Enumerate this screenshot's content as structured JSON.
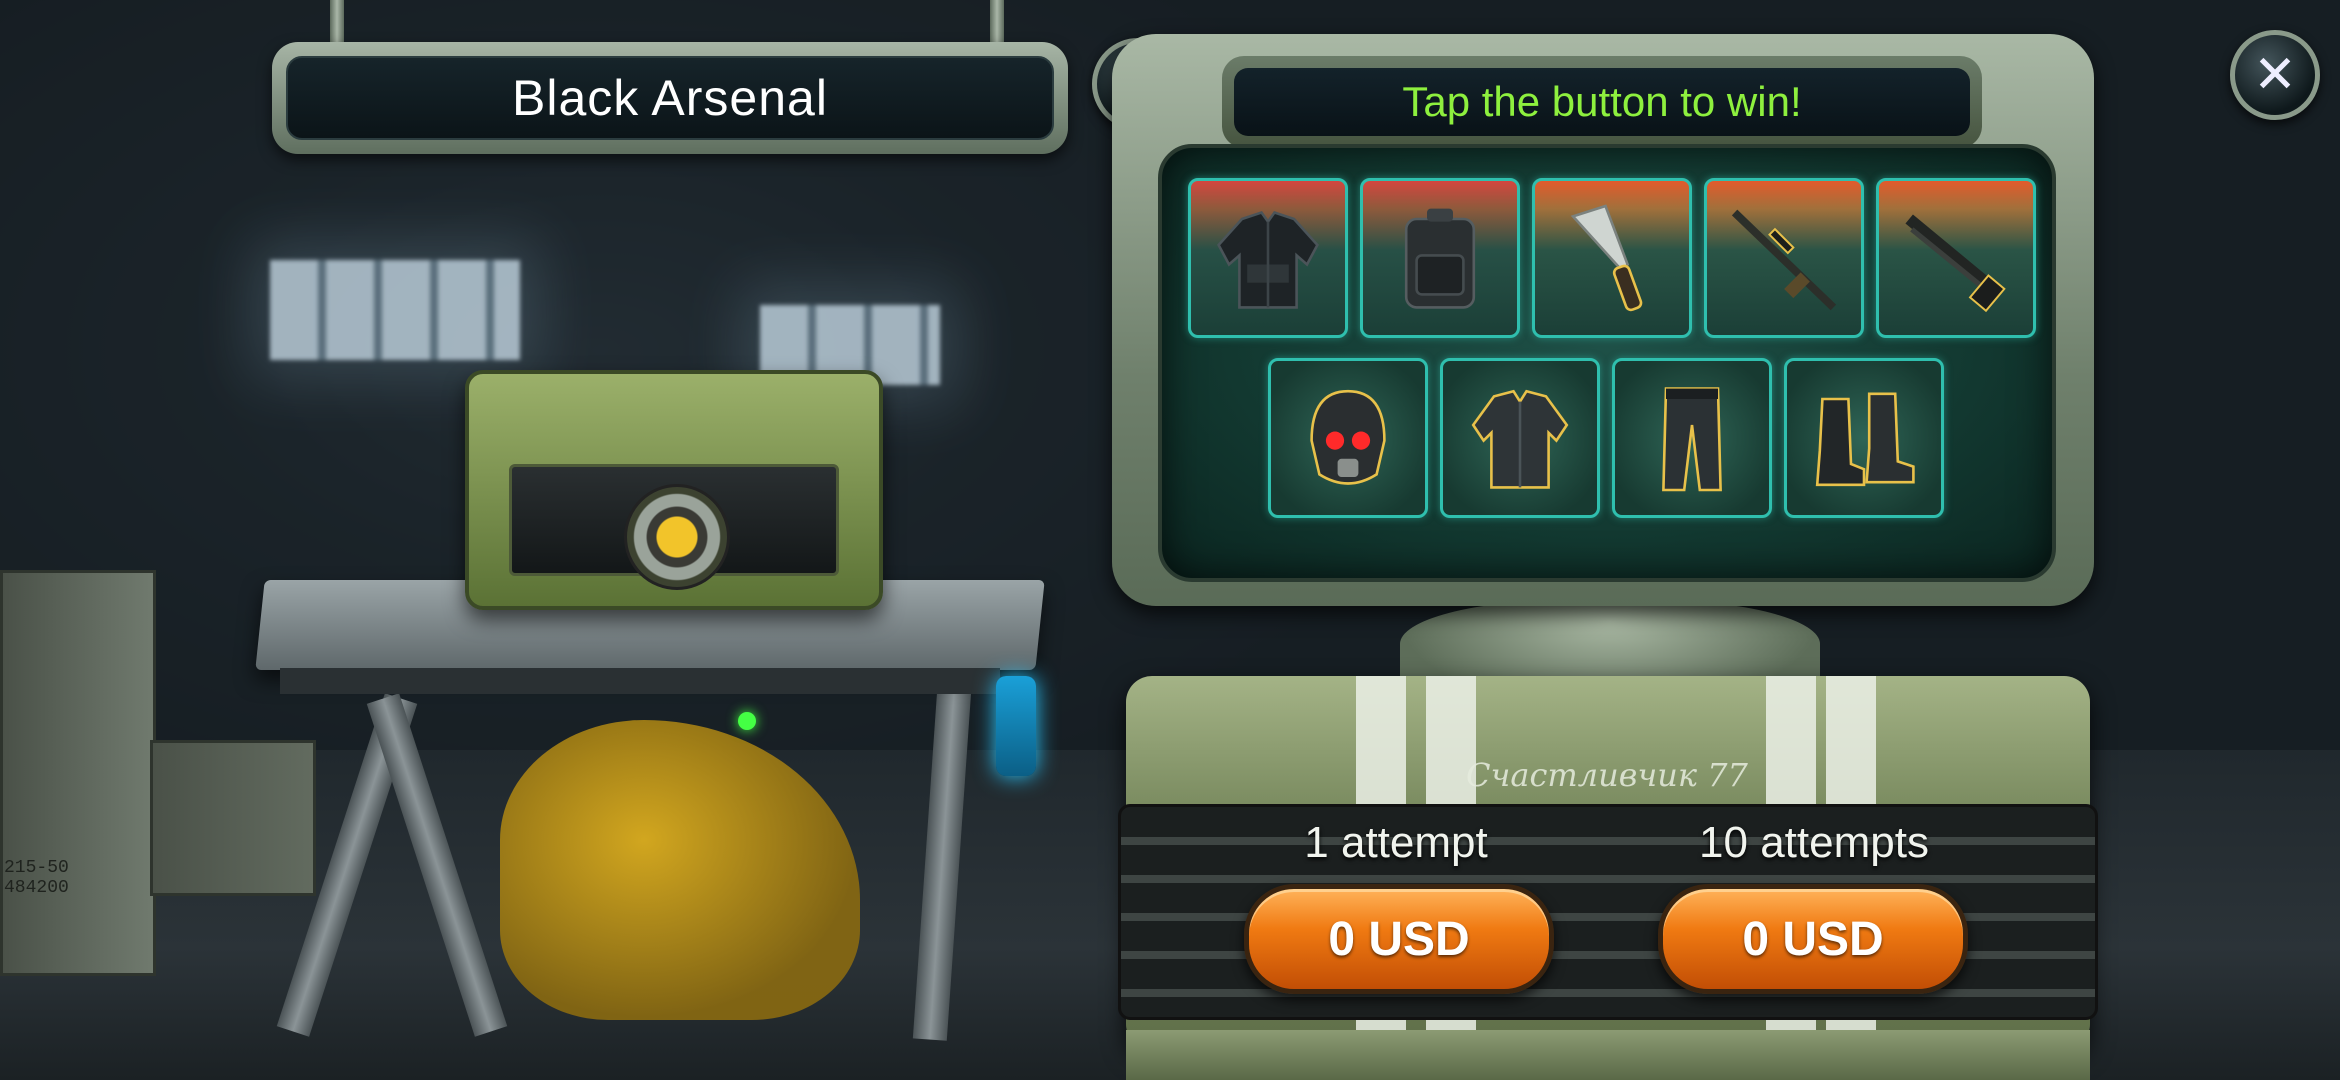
{
  "title": "Black Arsenal",
  "monitor": {
    "header": "Tap the button to win!"
  },
  "help_icon": "?",
  "close_icon": "✕",
  "machine": {
    "name": "Счастливчик 77"
  },
  "crate_label": "215-50\n484200",
  "rewards_row1": [
    {
      "id": "jacket",
      "rarity": "rare"
    },
    {
      "id": "backpack",
      "rarity": "rare"
    },
    {
      "id": "machete",
      "rarity": "epic"
    },
    {
      "id": "sniper-rifle",
      "rarity": "epic"
    },
    {
      "id": "shotgun",
      "rarity": "epic"
    }
  ],
  "rewards_row2": [
    {
      "id": "helmet",
      "rarity": "normal"
    },
    {
      "id": "armor-jacket",
      "rarity": "normal"
    },
    {
      "id": "pants",
      "rarity": "normal"
    },
    {
      "id": "boots",
      "rarity": "normal"
    }
  ],
  "buy_options": [
    {
      "label": "1 attempt",
      "price": "0 USD"
    },
    {
      "label": "10 attempts",
      "price": "0 USD"
    }
  ],
  "colors": {
    "accent_green": "#8ef03e",
    "button_orange": "#f07a12",
    "slot_border": "#2fbfae"
  }
}
